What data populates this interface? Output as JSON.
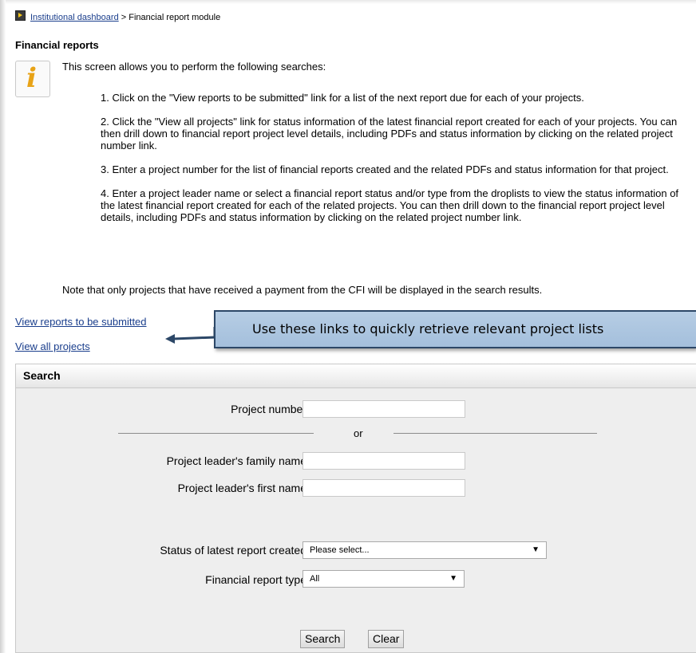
{
  "breadcrumb": {
    "home_link": "Institutional dashboard",
    "separator": ">",
    "current": "Financial report module"
  },
  "page_title": "Financial reports",
  "info": {
    "icon": "info-icon",
    "intro": "This screen allows you to perform the following searches:",
    "steps": [
      "1. Click on the \"View reports to be submitted\" link for a list of the next report due for each of your projects.",
      "2. Click the \"View all projects\" link for status information of the latest financial report created for each of your projects. You can then drill down to financial report project level details, including PDFs and status information by clicking on the related project number link.",
      "3. Enter a project number for the list of financial reports created and the related PDFs and status information for that project.",
      "4. Enter a project leader name or select a financial report status and/or type from the droplists to view the status information of the latest financial report created for each of the related projects. You can then drill down to the financial report project level details, including PDFs and status information by clicking on the related project number link."
    ],
    "note": "Note that only projects that have received a payment from the CFI will be displayed in the search results."
  },
  "links": {
    "view_reports": "View reports to be submitted",
    "view_all": "View all projects"
  },
  "callout": {
    "text": "Use these links to quickly retrieve relevant project lists",
    "color": "#b0c8e1"
  },
  "search": {
    "header": "Search",
    "project_number_label": "Project number",
    "project_number_value": "",
    "or_label": "or",
    "family_name_label": "Project leader's family name",
    "family_name_value": "",
    "first_name_label": "Project leader's first name",
    "first_name_value": "",
    "status_label": "Status of latest report created",
    "status_selected": "Please select...",
    "type_label": "Financial report type",
    "type_selected": "All",
    "search_button": "Search",
    "clear_button": "Clear"
  }
}
